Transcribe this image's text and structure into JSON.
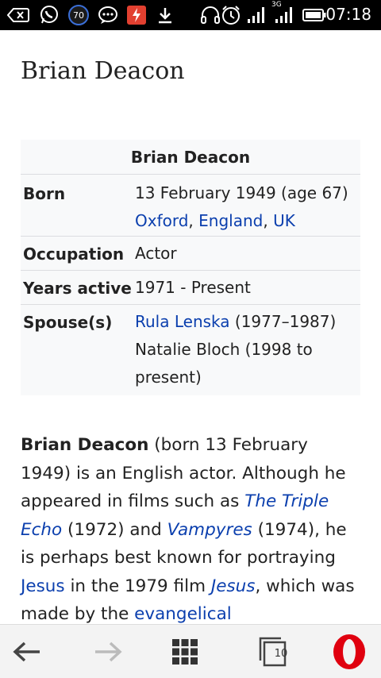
{
  "status_bar": {
    "time": "07:18",
    "notification_badge": "70",
    "network": "3G",
    "icons": [
      "screen-cast-icon",
      "whatsapp-icon",
      "badge-70-icon",
      "chat-bubble-icon",
      "app-notification-icon",
      "download-icon",
      "headphones-icon",
      "alarm-clock-icon",
      "signal-icon",
      "signal-3g-icon",
      "battery-icon"
    ]
  },
  "article": {
    "title": "Brian Deacon",
    "infobox": {
      "header": "Brian Deacon",
      "rows": [
        {
          "label": "Born",
          "line1": "13 February 1949 (age 67)",
          "links": [
            "Oxford",
            "England",
            "UK"
          ]
        },
        {
          "label": "Occupation",
          "value": "Actor"
        },
        {
          "label": "Years active",
          "value": "1971 - Present"
        },
        {
          "label": "Spouse(s)",
          "spouse1_link": "Rula Lenska",
          "spouse1_years": "(1977–1987)",
          "spouse2": "Natalie Bloch",
          "spouse2_years": "(1998 to",
          "spouse2_end": "present)"
        }
      ]
    },
    "intro": {
      "bold_name": "Brian Deacon",
      "t1": "(born 13 February 1949) is an English actor. Although he appeared in films such as",
      "film1": "The Triple Echo",
      "t2": "(1972) and",
      "film2": "Vampyres",
      "t3": "(1974), he is perhaps best known for portraying",
      "jesus_link": "Jesus",
      "t4": "in the 1979 film",
      "film3": "Jesus",
      "t5": ", which was made by the",
      "evangelical_link": "evangelical"
    }
  },
  "bottom_nav": {
    "tab_count": "10",
    "back": "back-arrow-icon",
    "forward": "forward-arrow-icon",
    "speed_dial": "grid-icon",
    "tabs": "tabs-icon",
    "opera": "opera-logo-icon"
  },
  "colors": {
    "link": "#0b3fae",
    "infobox_bg": "#f8f9fa",
    "status_bar": "#000000",
    "opera_red": "#e0000f"
  }
}
